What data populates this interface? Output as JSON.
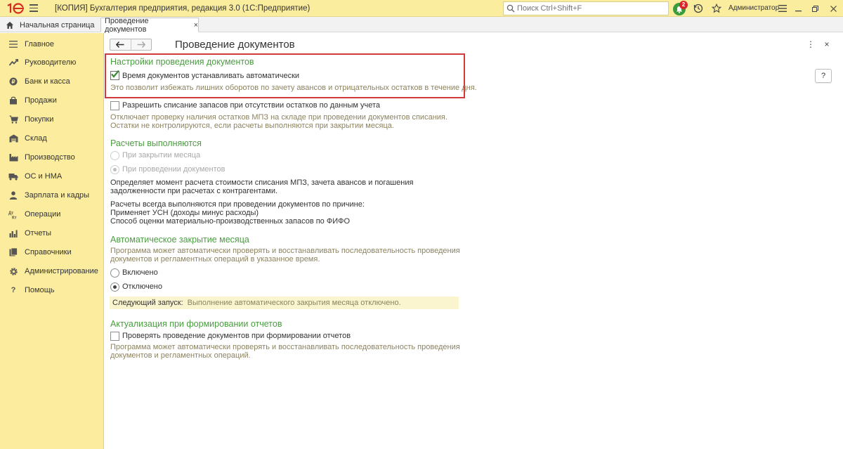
{
  "titlebar": {
    "logo_text": "1С",
    "app_title": "[КОПИЯ] Бухгалтерия предприятия, редакция 3.0  (1С:Предприятие)",
    "search_placeholder": "Поиск Ctrl+Shift+F",
    "notifications_count": "2",
    "user": "Администратор",
    "accent_color": "#fbed9e"
  },
  "tabs": {
    "home": "Начальная страница",
    "active": "Проведение документов",
    "close": "×"
  },
  "sidebar": {
    "items": [
      {
        "label": "Главное",
        "icon": "menu-icon"
      },
      {
        "label": "Руководителю",
        "icon": "trend-icon"
      },
      {
        "label": "Банк и касса",
        "icon": "coin-icon"
      },
      {
        "label": "Продажи",
        "icon": "bag-icon"
      },
      {
        "label": "Покупки",
        "icon": "cart-icon"
      },
      {
        "label": "Склад",
        "icon": "warehouse-icon"
      },
      {
        "label": "Производство",
        "icon": "factory-icon"
      },
      {
        "label": "ОС и НМА",
        "icon": "truck-icon"
      },
      {
        "label": "Зарплата и кадры",
        "icon": "person-icon"
      },
      {
        "label": "Операции",
        "icon": "debit-credit-icon"
      },
      {
        "label": "Отчеты",
        "icon": "bar-chart-icon"
      },
      {
        "label": "Справочники",
        "icon": "books-icon"
      },
      {
        "label": "Администрирование",
        "icon": "gear-icon"
      },
      {
        "label": "Помощь",
        "icon": "question-icon"
      }
    ]
  },
  "page": {
    "title": "Проведение документов",
    "help": "?",
    "more": "⋮",
    "close": "×"
  },
  "settings": {
    "section_title": "Настройки проведения документов",
    "auto_time_label": "Время документов устанавливать автоматически",
    "auto_time_checked": true,
    "auto_time_hint": "Это позволит избежать лишних оборотов по зачету авансов и отрицательных остатков в течение дня.",
    "allow_writeoff_label": "Разрешить списание запасов при отсутствии остатков по данным учета",
    "allow_writeoff_checked": false,
    "allow_writeoff_hint_1": "Отключает проверку наличия остатков МПЗ на складе при проведении документов списания.",
    "allow_writeoff_hint_2": "Остатки не контролируются, если расчеты выполняются при закрытии месяца."
  },
  "calc": {
    "section_title": "Расчеты выполняются",
    "option_month_close": "При закрытии месяца",
    "option_posting": "При проведении документов",
    "selected": "option_posting",
    "desc_1": "Определяет момент расчета стоимости списания МПЗ, зачета авансов и погашения",
    "desc_2": "задолженности при расчетах с контрагентами.",
    "reason_intro": "Расчеты всегда выполняются при проведении документов по причине:",
    "reason_1": "Применяет УСН (доходы минус расходы)",
    "reason_2": "Способ оценки материально-производственных запасов по ФИФО"
  },
  "auto_close": {
    "section_title": "Автоматическое закрытие месяца",
    "hint_1": "Программа может автоматически проверять и восстанавливать последовательность проведения",
    "hint_2": "документов и регламентных операций в указанное время.",
    "option_on": "Включено",
    "option_off": "Отключено",
    "selected": "option_off",
    "next_run_label": "Следующий запуск:",
    "next_run_value": "Выполнение автоматического закрытия месяца отключено."
  },
  "reports": {
    "section_title": "Актуализация при формировании отчетов",
    "check_label": "Проверять проведение документов при формировании отчетов",
    "check_checked": false,
    "hint_1": "Программа может автоматически проверять и восстанавливать последовательность проведения",
    "hint_2": "документов и регламентных операций."
  }
}
